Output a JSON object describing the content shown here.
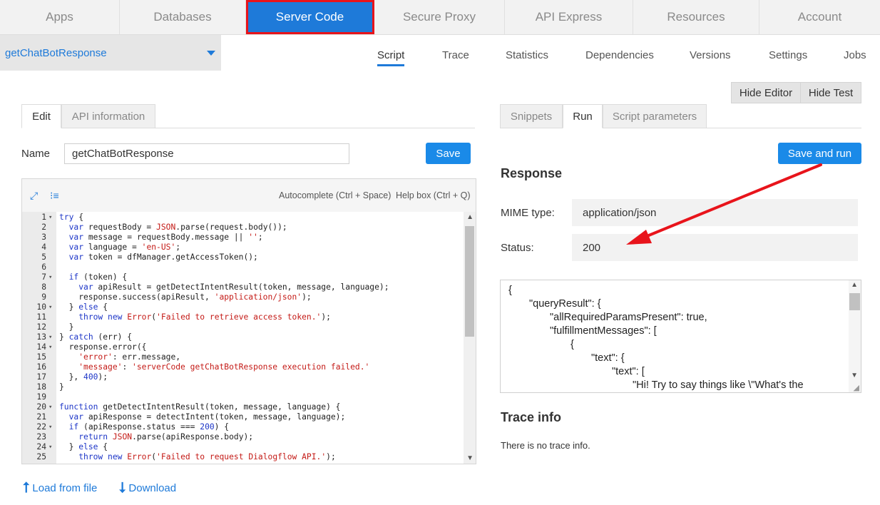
{
  "topnav": {
    "tabs": [
      {
        "label": "Apps"
      },
      {
        "label": "Databases"
      },
      {
        "label": "Server Code"
      },
      {
        "label": "Secure Proxy"
      },
      {
        "label": "API Express"
      },
      {
        "label": "Resources"
      },
      {
        "label": "Account"
      }
    ],
    "active_index": 2
  },
  "subnav": {
    "selected_script": "getChatBotResponse",
    "tabs": [
      {
        "label": "Script"
      },
      {
        "label": "Trace"
      },
      {
        "label": "Statistics"
      },
      {
        "label": "Dependencies"
      },
      {
        "label": "Versions"
      },
      {
        "label": "Settings"
      },
      {
        "label": "Jobs"
      }
    ],
    "active": "Script"
  },
  "toggles": {
    "hide_editor": "Hide Editor",
    "hide_test": "Hide Test"
  },
  "left": {
    "tabs": [
      {
        "label": "Edit"
      },
      {
        "label": "API information"
      }
    ],
    "active_tab": "Edit",
    "name_label": "Name",
    "name_value": "getChatBotResponse",
    "save_label": "Save",
    "editor": {
      "autocomplete_hint": "Autocomplete (Ctrl + Space)",
      "help_hint": "Help box (Ctrl + Q)",
      "lines": [
        {
          "n": "1",
          "fold": true,
          "text": "try {"
        },
        {
          "n": "2",
          "fold": false,
          "text": "  var requestBody = JSON.parse(request.body());"
        },
        {
          "n": "3",
          "fold": false,
          "text": "  var message = requestBody.message || '';"
        },
        {
          "n": "4",
          "fold": false,
          "text": "  var language = 'en-US';"
        },
        {
          "n": "5",
          "fold": false,
          "text": "  var token = dfManager.getAccessToken();"
        },
        {
          "n": "6",
          "fold": false,
          "text": ""
        },
        {
          "n": "7",
          "fold": true,
          "text": "  if (token) {"
        },
        {
          "n": "8",
          "fold": false,
          "text": "    var apiResult = getDetectIntentResult(token, message, language);"
        },
        {
          "n": "9",
          "fold": false,
          "text": "    response.success(apiResult, 'application/json');"
        },
        {
          "n": "10",
          "fold": true,
          "text": "  } else {"
        },
        {
          "n": "11",
          "fold": false,
          "text": "    throw new Error('Failed to retrieve access token.');"
        },
        {
          "n": "12",
          "fold": false,
          "text": "  }"
        },
        {
          "n": "13",
          "fold": true,
          "text": "} catch (err) {"
        },
        {
          "n": "14",
          "fold": true,
          "text": "  response.error({"
        },
        {
          "n": "15",
          "fold": false,
          "text": "    'error': err.message,"
        },
        {
          "n": "16",
          "fold": false,
          "text": "    'message': 'serverCode getChatBotResponse execution failed.'"
        },
        {
          "n": "17",
          "fold": false,
          "text": "  }, 400);"
        },
        {
          "n": "18",
          "fold": false,
          "text": "}"
        },
        {
          "n": "19",
          "fold": false,
          "text": ""
        },
        {
          "n": "20",
          "fold": true,
          "text": "function getDetectIntentResult(token, message, language) {"
        },
        {
          "n": "21",
          "fold": false,
          "text": "  var apiResponse = detectIntent(token, message, language);"
        },
        {
          "n": "22",
          "fold": true,
          "text": "  if (apiResponse.status === 200) {"
        },
        {
          "n": "23",
          "fold": false,
          "text": "    return JSON.parse(apiResponse.body);"
        },
        {
          "n": "24",
          "fold": true,
          "text": "  } else {"
        },
        {
          "n": "25",
          "fold": false,
          "text": "    throw new Error('Failed to request Dialogflow API.');"
        }
      ]
    },
    "load_from_file": "Load from file",
    "download": "Download"
  },
  "right": {
    "tabs": [
      {
        "label": "Snippets"
      },
      {
        "label": "Run"
      },
      {
        "label": "Script parameters"
      }
    ],
    "active_tab": "Run",
    "save_and_run": "Save and run",
    "response_title": "Response",
    "mime_label": "MIME type:",
    "mime_value": "application/json",
    "status_label": "Status:",
    "status_value": "200",
    "json_lines": [
      "{",
      "\"queryResult\": {",
      "\"allRequiredParamsPresent\": true,",
      "\"fulfillmentMessages\": [",
      "{",
      "\"text\": {",
      "\"text\": [",
      "\"Hi! Try to say things like \\\"What's the"
    ],
    "json_indent": [
      0,
      1,
      2,
      2,
      3,
      4,
      5,
      6
    ],
    "trace_title": "Trace info",
    "trace_text": "There is no trace info."
  },
  "colors": {
    "accent": "#1e7ad9",
    "button": "#1a8ae8",
    "highlight": "#e8141b"
  }
}
